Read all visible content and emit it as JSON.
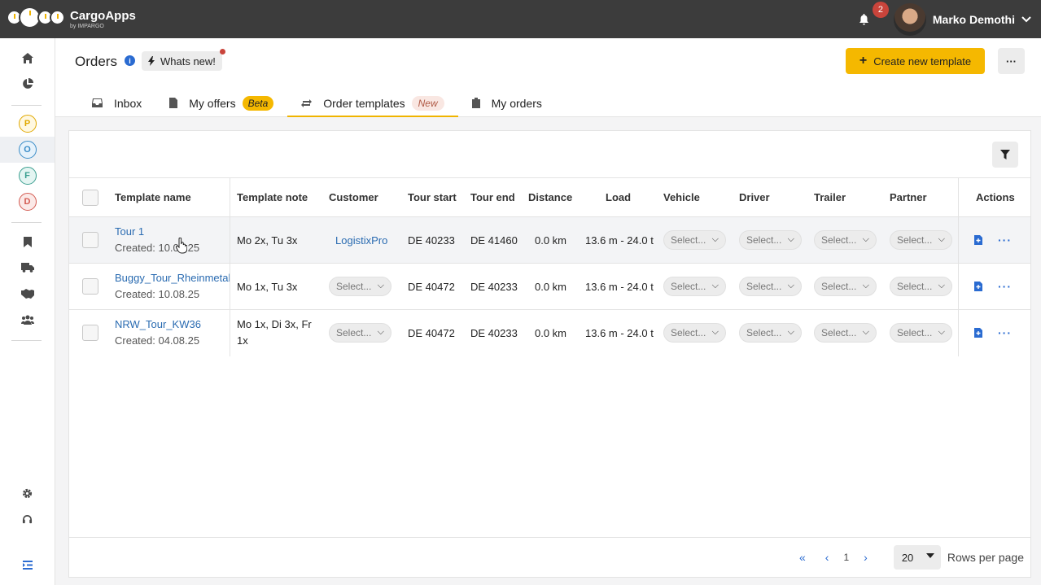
{
  "app": {
    "name": "CargoApps",
    "sub": "by IMPARGO"
  },
  "notifications": {
    "count": "2"
  },
  "user": {
    "name": "Marko Demothi"
  },
  "sidebar": {
    "letters": [
      {
        "label": "P",
        "color": "#e0a800"
      },
      {
        "label": "O",
        "color": "#3a8cc7"
      },
      {
        "label": "F",
        "color": "#3a9e8f"
      },
      {
        "label": "D",
        "color": "#d35b52"
      }
    ]
  },
  "page": {
    "title": "Orders",
    "whats_new": "Whats new!",
    "create_button": "Create new template",
    "more_button": "···"
  },
  "tabs": [
    {
      "label": "Inbox"
    },
    {
      "label": "My offers",
      "badge": "Beta"
    },
    {
      "label": "Order templates",
      "badge": "New"
    },
    {
      "label": "My orders"
    }
  ],
  "table": {
    "columns": [
      "Template name",
      "Template note",
      "Customer",
      "Tour start",
      "Tour end",
      "Distance",
      "Load",
      "Vehicle",
      "Driver",
      "Trailer",
      "Partner",
      "Actions"
    ],
    "select_placeholder": "Select...",
    "rows": [
      {
        "name": "Tour 1",
        "created": "Created: 10.08.25",
        "note": "Mo 2x, Tu 3x",
        "customer": "LogistixPro",
        "start": "DE 40233",
        "end": "DE 41460",
        "distance": "0.0 km",
        "load": "13.6 m - 24.0 t"
      },
      {
        "name": "Buggy_Tour_Rheinmetall",
        "created": "Created: 10.08.25",
        "note": "Mo 1x, Tu 3x",
        "customer": "",
        "start": "DE 40472",
        "end": "DE 40233",
        "distance": "0.0 km",
        "load": "13.6 m - 24.0 t"
      },
      {
        "name": "NRW_Tour_KW36",
        "created": "Created: 04.08.25",
        "note": "Mo 1x, Di 3x, Fr 1x",
        "customer": "",
        "start": "DE 40472",
        "end": "DE 40233",
        "distance": "0.0 km",
        "load": "13.6 m - 24.0 t"
      }
    ]
  },
  "pagination": {
    "current": "1",
    "rows_per_page": "20",
    "rows_label": "Rows per page"
  }
}
